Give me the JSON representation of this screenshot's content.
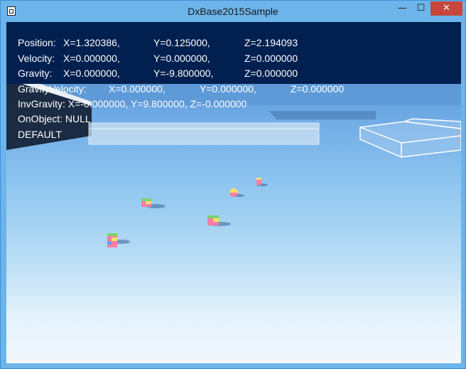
{
  "window": {
    "title": "DxBase2015Sample",
    "minimize_glyph": "—",
    "maximize_glyph": "☐",
    "close_glyph": "✕"
  },
  "hud": {
    "position": {
      "label": "Position:",
      "x": "X=1.320386,",
      "y": "Y=0.125000,",
      "z": "Z=2.194093"
    },
    "velocity": {
      "label": "Velocity:",
      "x": "X=0.000000,",
      "y": "Y=0.000000,",
      "z": "Z=0.000000"
    },
    "gravity": {
      "label": "Gravity:",
      "x": "X=0.000000,",
      "y": "Y=-9.800000,",
      "z": "Z=0.000000"
    },
    "gravity_velocity": {
      "label": "GravityVelocity:",
      "x": "X=0.000000,",
      "y": "Y=0.000000,",
      "z": "Z=0.000000"
    },
    "inv_gravity": "InvGravity: X=-0.000000, Y=9.800000, Z=-0.000000",
    "on_object": "OnObject: NULL",
    "mode": "DEFAULT"
  },
  "colors": {
    "titlebar": "#6cb4ea",
    "hud_background": "#02204f",
    "close_button": "#c7463b",
    "sky_top": "#4b86cc",
    "floor_bottom": "#f2f8fd"
  }
}
